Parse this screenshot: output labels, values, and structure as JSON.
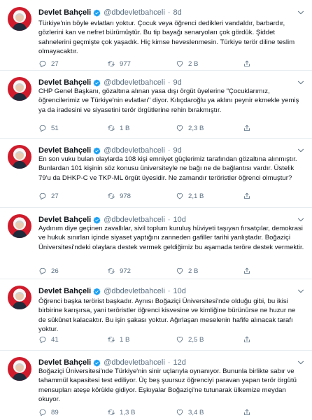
{
  "account": {
    "name": "Devlet Bahçeli",
    "handle": "@dbdevletbahceli",
    "separator": "·"
  },
  "icons": {
    "verified": "verified-badge-icon",
    "more": "chevron-down-icon",
    "reply": "reply-icon",
    "retweet": "retweet-icon",
    "like": "heart-icon",
    "share": "share-icon"
  },
  "colors": {
    "accent": "#1da1f2",
    "muted": "#5b7083",
    "divider": "#e6ecf0",
    "avatar_red": "#cf1b2b"
  },
  "tweets": [
    {
      "time": "8d",
      "text": "Türkiye'nin böyle evlatları yoktur. Çocuk veya öğrenci dedikleri vandaldır, barbardır, gözlerini kan ve nefret bürümüştür. Bu tip bayağı senaryoları çok gördük. Şiddet sahnelerini geçmişte çok yaşadık. Hiç kimse heveslenmesin. Türkiye terör diline teslim olmayacaktır.",
      "replies": "27",
      "retweets": "977",
      "likes": "2 B"
    },
    {
      "time": "9d",
      "text": "CHP Genel Başkanı, gözaltına alınan yasa dışı örgüt üyelerine \"Çocuklarımız, öğrencilerimiz ve Türkiye'nin evlatları\" diyor. Kılıçdaroğlu ya aklını peynir ekmekle yemiş ya da iradesini ve siyasetini terör örgütlerine rehin bırakmıştır.",
      "replies": "51",
      "retweets": "1 B",
      "likes": "2,3 B"
    },
    {
      "time": "9d",
      "text": "En son vuku bulan olaylarda 108 kişi emniyet güçlerimiz tarafından gözaltına alınmıştır. Bunlardan 101 kişinin söz konusu üniversiteyle ne bağı ne de bağlantısı vardır. Üstelik 79'u da DHKP-C ve TKP-ML örgüt üyesidir. Ne zamandır teröristler öğrenci olmuştur?",
      "replies": "27",
      "retweets": "978",
      "likes": "2,1 B"
    },
    {
      "time": "10d",
      "text": "Aydınım diye geçinen zavallılar, sivil toplum kuruluş hüviyeti taşıyan fırsatçılar, demokrasi ve hukuk sınırları içinde siyaset yaptığını zanneden gafiller tarihi yanlıştadır. Boğaziçi Üniversitesi'ndeki olaylara destek vermek geldiğimiz bu aşamada teröre destek vermektir.",
      "replies": "26",
      "retweets": "972",
      "likes": "2 B"
    },
    {
      "time": "10d",
      "text": "Öğrenci başka terörist başkadır. Aynısı Boğaziçi Üniversitesi'nde olduğu gibi, bu ikisi birbirine karışırsa, yani teröristler öğrenci kisvesine ve kimliğine bürünürse ne huzur ne de sükûnet kalacaktır. Bu işin şakası yoktur. Ağırlaşan meselenin hafife alınacak tarafı yoktur.",
      "replies": "41",
      "retweets": "1 B",
      "likes": "2,5 B"
    },
    {
      "time": "12d",
      "text": "Boğaziçi Üniversitesi'nde Türkiye'nin sinir uçlarıyla oynanıyor. Bununla birlikte sabır ve tahammül kapasitesi test ediliyor. Üç beş şuursuz öğrenciyi paravan yapan terör örgütü mensupları ateşe körükle gidiyor. Eşkıyalar Boğaziçi'ne tutunarak ülkemize meydan okuyor.",
      "replies": "89",
      "retweets": "1,3 B",
      "likes": "3,4 B"
    }
  ]
}
